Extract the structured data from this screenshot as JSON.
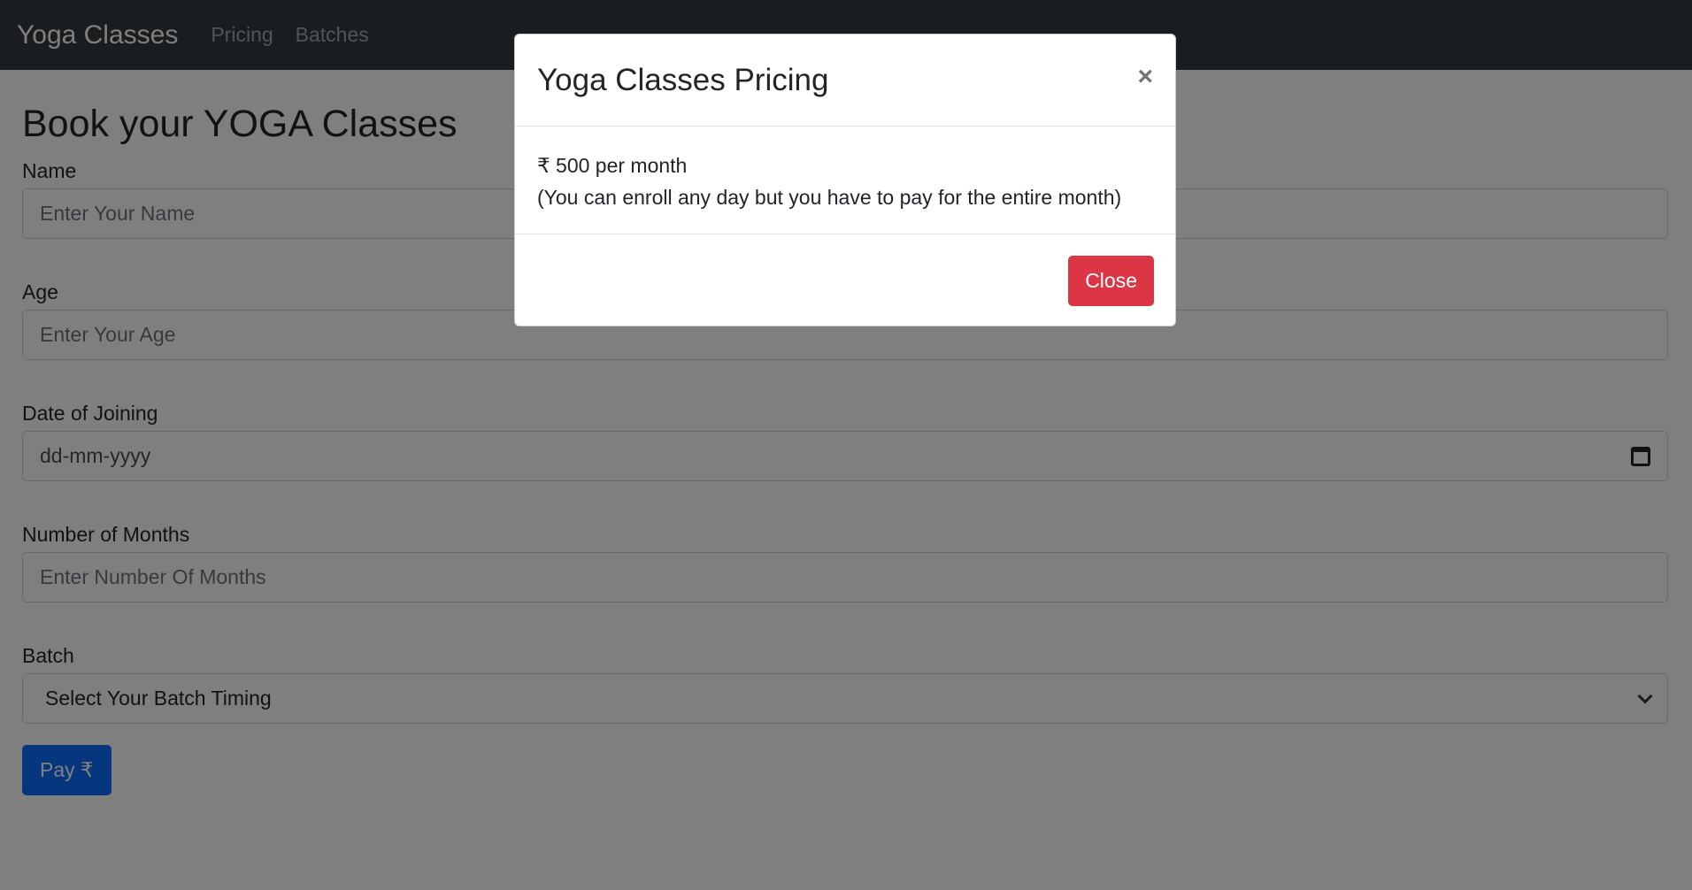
{
  "navbar": {
    "brand": "Yoga Classes",
    "links": [
      "Pricing",
      "Batches"
    ]
  },
  "form": {
    "title": "Book your YOGA Classes",
    "name": {
      "label": "Name",
      "placeholder": "Enter Your Name"
    },
    "age": {
      "label": "Age",
      "placeholder": "Enter Your Age"
    },
    "date": {
      "label": "Date of Joining",
      "placeholder": "dd-mm-yyyy",
      "icon": "calendar-icon"
    },
    "months": {
      "label": "Number of Months",
      "placeholder": "Enter Number Of Months"
    },
    "batch": {
      "label": "Batch",
      "selected": "Select Your Batch Timing",
      "icon": "chevron-down-icon"
    },
    "pay_label": "Pay ₹"
  },
  "modal": {
    "title": "Yoga Classes Pricing",
    "close_glyph": "×",
    "body_line1": "₹ 500 per month",
    "body_line2": "(You can enroll any day but you have to pay for the entire month)",
    "close_label": "Close"
  },
  "colors": {
    "navbar_bg": "#343a40",
    "primary": "#0d6efd",
    "danger": "#dc3545"
  }
}
